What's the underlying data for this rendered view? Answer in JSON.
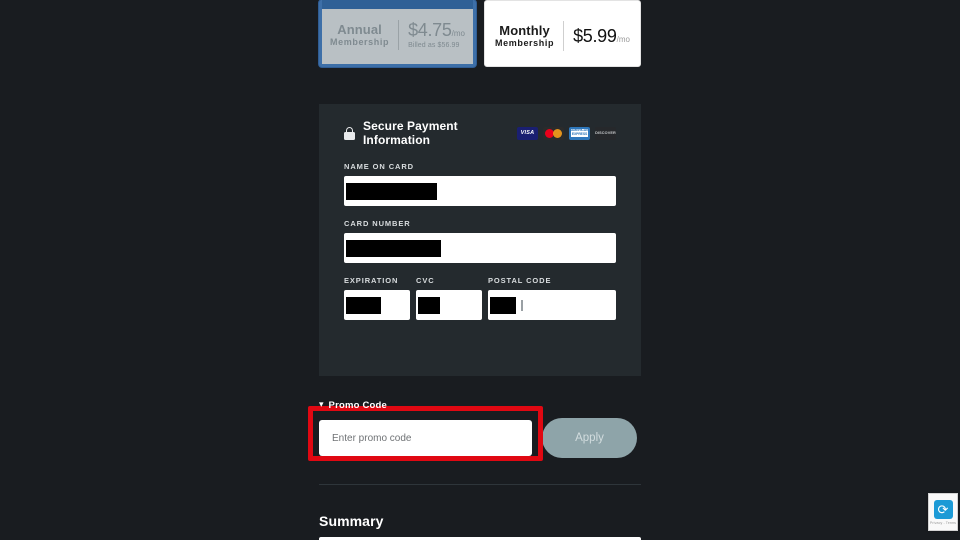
{
  "plans": [
    {
      "name": "Annual",
      "subtitle": "Membership",
      "price": "$4.75",
      "period": "/mo",
      "billed_note": "Billed as $56.99",
      "state": "disabled",
      "banner": ""
    },
    {
      "name": "Monthly",
      "subtitle": "Membership",
      "price": "$5.99",
      "period": "/mo",
      "billed_note": "",
      "state": "selected",
      "banner": ""
    }
  ],
  "payment": {
    "title": "Secure Payment Information",
    "lock_icon": "lock-icon",
    "card_logos": [
      {
        "name": "visa-logo",
        "label": "VISA"
      },
      {
        "name": "mastercard-logo",
        "label": ""
      },
      {
        "name": "amex-logo",
        "label": "AMERICAN"
      },
      {
        "name": "amex-logo-line2",
        "label": "EXPRESS"
      },
      {
        "name": "discover-logo",
        "label": "DISCOVER"
      }
    ],
    "fields": {
      "name_on_card": {
        "label": "NAME ON CARD",
        "value": "",
        "redacted": true
      },
      "card_number": {
        "label": "CARD NUMBER",
        "value": "",
        "redacted": true
      },
      "expiration": {
        "label": "EXPIRATION",
        "value": "",
        "redacted": true
      },
      "cvc": {
        "label": "CVC",
        "value": "",
        "redacted": true
      },
      "postal_code": {
        "label": "POSTAL CODE",
        "value": "",
        "redacted": true
      }
    }
  },
  "promo": {
    "chevron_icon": "chevron-down-icon",
    "label": "Promo Code",
    "placeholder": "Enter promo code",
    "value": "",
    "apply_label": "Apply",
    "highlight_color": "#e00812"
  },
  "summary": {
    "title": "Summary"
  },
  "recaptcha": {
    "text": "Privacy - Terms"
  },
  "colors": {
    "page_background": "#191c20",
    "panel_background": "#242a2e",
    "accent_blue": "#2f6096",
    "apply_button": "#8ea4a9",
    "highlight_red": "#e00812"
  }
}
